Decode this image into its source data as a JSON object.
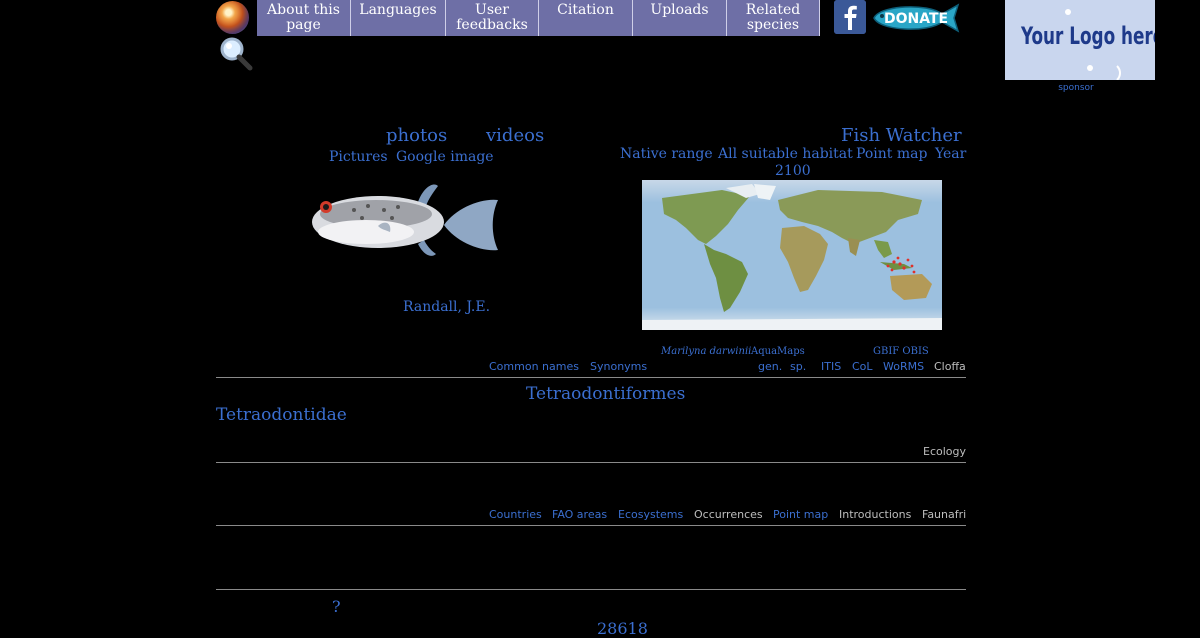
{
  "topnav": {
    "tabs": [
      {
        "label": "About this page"
      },
      {
        "label": "Languages"
      },
      {
        "label": "User feedbacks"
      },
      {
        "label": "Citation"
      },
      {
        "label": "Uploads"
      },
      {
        "label": "Related species"
      }
    ]
  },
  "donate_label": "DONATE",
  "logo": {
    "text": "Your Logo here",
    "sponsor": "sponsor"
  },
  "media": {
    "photos": "photos",
    "videos": "videos",
    "pictures": "Pictures",
    "google_image": "Google image",
    "photo_credit": "Randall, J.E."
  },
  "map_panel": {
    "title": "Fish Watcher",
    "links": [
      "Native range",
      "All suitable habitat",
      "Point map",
      "Year"
    ],
    "year": "2100"
  },
  "names_row": {
    "common_names": "Common names",
    "synonyms": "Synonyms",
    "aquamaps_species": "Marilyna darwinii",
    "aquamaps": "AquaMaps",
    "gen": "gen.",
    "sp": "sp.",
    "gbif_obis": "GBIF OBIS",
    "itis": "ITIS",
    "col": "CoL",
    "worms": "WoRMS",
    "cloffa": "Cloffa"
  },
  "taxonomy": {
    "order": "Tetraodontiformes",
    "family": "Tetraodontidae"
  },
  "ecology_label": "Ecology",
  "distribution_row": [
    "Countries",
    "FAO areas",
    "Ecosystems",
    "Occurrences",
    "Point map",
    "Introductions",
    "Faunafri"
  ],
  "bottom": {
    "question": "?",
    "number": "28618"
  },
  "colors": {
    "tab_bg": "#6e6fa6",
    "link": "#3b6fd0",
    "bg": "#000000"
  }
}
